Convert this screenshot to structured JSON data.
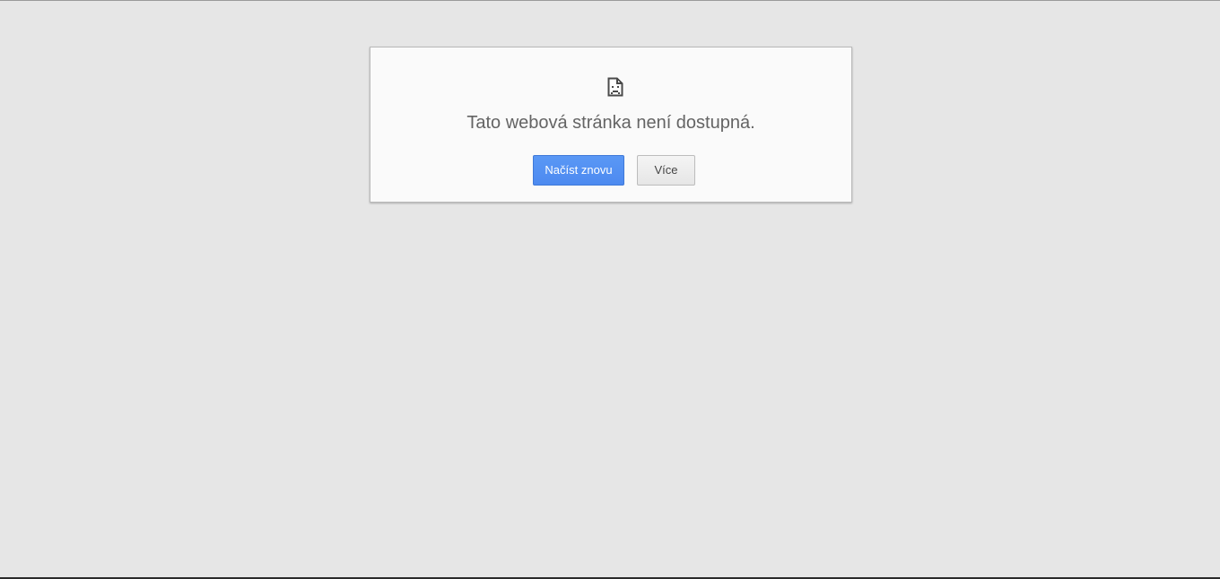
{
  "error": {
    "icon": "sad-page-icon",
    "title": "Tato webová stránka není dostupná."
  },
  "buttons": {
    "reload_label": "Načíst znovu",
    "more_label": "Více"
  },
  "colors": {
    "background": "#e6e6e6",
    "card": "#fafafa",
    "primary_button": "#4d8af0",
    "title_text": "#646464"
  }
}
